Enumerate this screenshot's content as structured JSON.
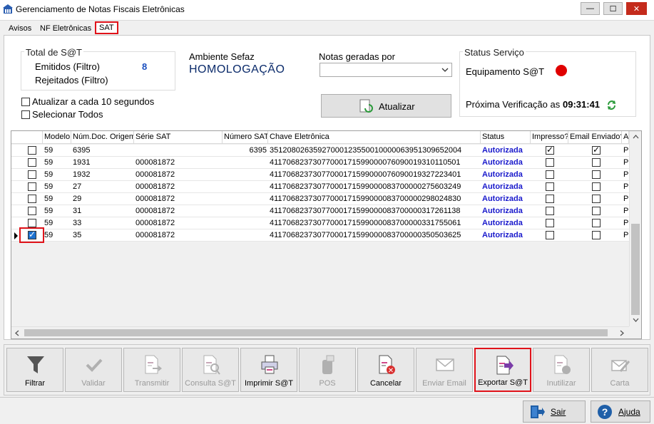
{
  "window": {
    "title": "Gerenciamento de Notas Fiscais Eletrônicas"
  },
  "tabs": [
    {
      "label": "Avisos"
    },
    {
      "label": "NF Eletrônicas"
    },
    {
      "label": "SAT"
    }
  ],
  "totals": {
    "title": "Total de S@T",
    "emitidos_label": "Emitidos (Filtro)",
    "emitidos_value": "8",
    "rejeitados_label": "Rejeitados (Filtro)"
  },
  "ambiente": {
    "label": "Ambiente Sefaz",
    "value": "HOMOLOGAÇÃO"
  },
  "notas": {
    "label": "Notas geradas por",
    "selected": ""
  },
  "status_servico": {
    "title": "Status Serviço",
    "equipamento_label": "Equipamento S@T",
    "status_color": "#e00000",
    "proxima_label": "Próxima Verificação as",
    "proxima_value": "09:31:41"
  },
  "options": {
    "auto_refresh": "Atualizar a cada 10 segundos",
    "select_all": "Selecionar Todos"
  },
  "atualizar_label": "Atualizar",
  "grid": {
    "columns": [
      "Modelo",
      "Núm.Doc. Origem",
      "Série SAT",
      "Número SAT",
      "Chave Eletrônica",
      "Status",
      "Impresso?",
      "Email Enviado?",
      "A"
    ],
    "rows": [
      {
        "selected": false,
        "modelo": "59",
        "num_doc": "6395",
        "serie": "",
        "numero": "6395",
        "chave": "35120802635927000123550010000063951309652004",
        "status": "Autorizada",
        "impresso": true,
        "email": true,
        "a": "Pr"
      },
      {
        "selected": false,
        "modelo": "59",
        "num_doc": "1931",
        "serie": "000081872",
        "numero": "",
        "chave": "41170682373077000171599000076090019310110501",
        "status": "Autorizada",
        "impresso": false,
        "email": false,
        "a": "Pr"
      },
      {
        "selected": false,
        "modelo": "59",
        "num_doc": "1932",
        "serie": "000081872",
        "numero": "",
        "chave": "41170682373077000171599000076090019327223401",
        "status": "Autorizada",
        "impresso": false,
        "email": false,
        "a": "Pr"
      },
      {
        "selected": false,
        "modelo": "59",
        "num_doc": "27",
        "serie": "000081872",
        "numero": "",
        "chave": "41170682373077000171599000083700000275603249",
        "status": "Autorizada",
        "impresso": false,
        "email": false,
        "a": "Pr"
      },
      {
        "selected": false,
        "modelo": "59",
        "num_doc": "29",
        "serie": "000081872",
        "numero": "",
        "chave": "41170682373077000171599000083700000298024830",
        "status": "Autorizada",
        "impresso": false,
        "email": false,
        "a": "Pr"
      },
      {
        "selected": false,
        "modelo": "59",
        "num_doc": "31",
        "serie": "000081872",
        "numero": "",
        "chave": "41170682373077000171599000083700000317261138",
        "status": "Autorizada",
        "impresso": false,
        "email": false,
        "a": "Pr"
      },
      {
        "selected": false,
        "modelo": "59",
        "num_doc": "33",
        "serie": "000081872",
        "numero": "",
        "chave": "41170682373077000171599000083700000331755061",
        "status": "Autorizada",
        "impresso": false,
        "email": false,
        "a": "Pr"
      },
      {
        "selected": true,
        "modelo": "59",
        "num_doc": "35",
        "serie": "000081872",
        "numero": "",
        "chave": "41170682373077000171599000083700000350503625",
        "status": "Autorizada",
        "impresso": false,
        "email": false,
        "a": "Pr"
      }
    ]
  },
  "toolbar": {
    "buttons": [
      {
        "label": "Filtrar",
        "icon": "filter-icon",
        "enabled": true
      },
      {
        "label": "Validar",
        "icon": "check-icon",
        "enabled": false
      },
      {
        "label": "Transmitir",
        "icon": "transmit-icon",
        "enabled": false
      },
      {
        "label": "Consulta S@T",
        "icon": "search-document-icon",
        "enabled": false
      },
      {
        "label": "Imprimir S@T",
        "icon": "printer-icon",
        "enabled": true
      },
      {
        "label": "POS",
        "icon": "pos-terminal-icon",
        "enabled": false
      },
      {
        "label": "Cancelar",
        "icon": "cancel-document-icon",
        "enabled": true
      },
      {
        "label": "Enviar Email",
        "icon": "email-icon",
        "enabled": false
      },
      {
        "label": "Exportar S@T",
        "icon": "export-icon",
        "enabled": true
      },
      {
        "label": "Inutilizar",
        "icon": "disable-document-icon",
        "enabled": false
      },
      {
        "label": "Carta",
        "icon": "letter-icon",
        "enabled": false
      }
    ]
  },
  "footer": {
    "sair": "Sair",
    "ajuda": "Ajuda"
  },
  "colors": {
    "accent_red": "#e0131a",
    "status_blue": "#1a1acc"
  }
}
